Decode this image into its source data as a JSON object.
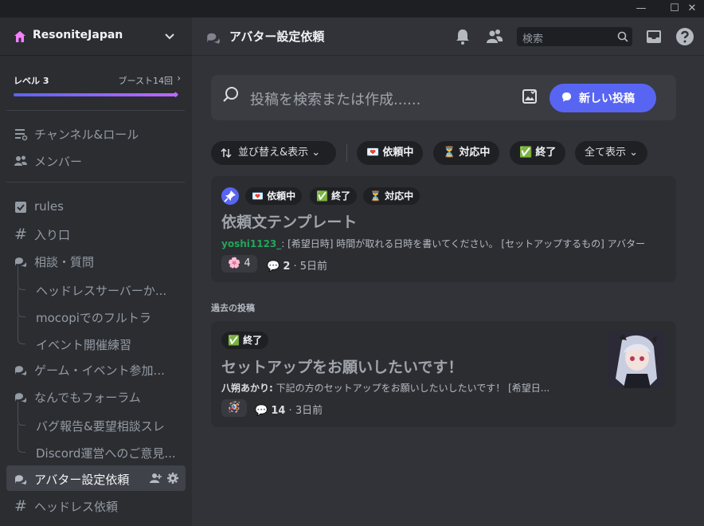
{
  "window": {
    "minimize": "—",
    "maximize": "☐",
    "close": "✕"
  },
  "server": {
    "name": "ResoniteJapan"
  },
  "boost": {
    "level": "レベル 3",
    "count": "ブースト14回"
  },
  "sidebar": {
    "top_items": [
      {
        "label": "チャンネル&ロール",
        "icon": "list-icon"
      },
      {
        "label": "メンバー",
        "icon": "members-icon"
      }
    ],
    "channels": [
      {
        "label": "rules",
        "icon": "rules-icon",
        "type": "channel"
      },
      {
        "label": "入り口",
        "icon": "hash-icon",
        "type": "channel"
      },
      {
        "label": "相談・質問",
        "icon": "forum-icon",
        "type": "forum"
      },
      {
        "label": "ヘッドレスサーバーか...",
        "type": "thread"
      },
      {
        "label": "mocopiでのフルトラ",
        "type": "thread"
      },
      {
        "label": "イベント開催練習",
        "type": "thread"
      },
      {
        "label": "ゲーム・イベント参加...",
        "icon": "forum-icon",
        "type": "forum"
      },
      {
        "label": "なんでもフォーラム",
        "icon": "forum-icon",
        "type": "forum"
      },
      {
        "label": "バグ報告&要望相談スレ",
        "type": "thread"
      },
      {
        "label": "Discord運営へのご意見...",
        "type": "thread"
      },
      {
        "label": "アバター設定依頼",
        "icon": "forum-icon",
        "type": "forum",
        "active": true
      },
      {
        "label": "ヘッドレス依頼",
        "icon": "hash-icon",
        "type": "channel"
      }
    ]
  },
  "header": {
    "title": "アバター設定依頼",
    "search_placeholder": "検索"
  },
  "composer": {
    "placeholder": "投稿を検索または作成......",
    "new_post": "新しい投稿"
  },
  "filters": {
    "sort": "並び替え&表示",
    "tags": [
      {
        "emoji": "💌",
        "label": "依頼中"
      },
      {
        "emoji": "⏳",
        "label": "対応中"
      },
      {
        "emoji": "✅",
        "label": "終了"
      }
    ],
    "show_all": "全て表示"
  },
  "pinned_post": {
    "tags": [
      {
        "emoji": "💌",
        "label": "依頼中"
      },
      {
        "emoji": "✅",
        "label": "終了"
      },
      {
        "emoji": "⏳",
        "label": "対応中"
      }
    ],
    "title": "依頼文テンプレート",
    "author": "yoshi1123_",
    "preview": ": [希望日時] 時間が取れる日時を書いてください。 [セットアップするもの] アバター",
    "reaction_emoji": "🌸",
    "reaction_count": "4",
    "comment_count": "2",
    "time": "5日前"
  },
  "past_label": "過去の投稿",
  "past_post": {
    "tags": [
      {
        "emoji": "✅",
        "label": "終了"
      }
    ],
    "title": "セットアップをお願いしたいです！",
    "author": "八朔あかり:",
    "preview": " 下記の方のセットアップをお願いしたいしたいです！ [希望日...",
    "reaction_emoji": "🪅",
    "comment_count": "14",
    "time": "3日前"
  },
  "colors": {
    "accent": "#5865f2",
    "author_green": "#23a55a",
    "bg_main": "#313338",
    "bg_sidebar": "#2b2d31"
  }
}
